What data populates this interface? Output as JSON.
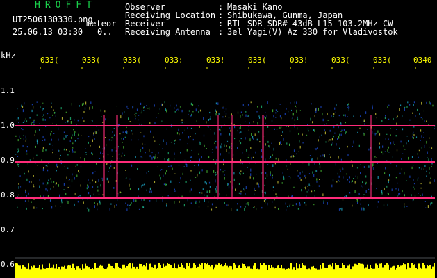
{
  "header": {
    "app_title": "HROFFT",
    "file_name": "UT2506130330.png",
    "mode": "meteor",
    "datetime": "25.06.13 03:30",
    "counter": "0..",
    "rows": [
      {
        "label": "Observer",
        "value": "Masaki Kano"
      },
      {
        "label": "Receiving Location",
        "value": "Shibukawa, Gunma, Japan"
      },
      {
        "label": "Receiver",
        "value": "RTL-SDR SDR# 43dB L15 103.2MHz CW"
      },
      {
        "label": "Receiving Antenna",
        "value": "3el Yagi(V) Az 330 for Vladivostok"
      }
    ]
  },
  "axis": {
    "y_unit": "kHz",
    "y_ticks": [
      "1.1",
      "1.0",
      "0.9",
      "0.8",
      "0.7",
      "0.6"
    ],
    "x_ticks": [
      "033(",
      "033(",
      "033(",
      "033:",
      "033!",
      "033(",
      "033!",
      "033(",
      "033(",
      "0340"
    ]
  },
  "colors": {
    "background": "#000000",
    "title_green": "#19d04b",
    "tick_yellow": "#ffff00",
    "signal_magenta": "#ff2b7a",
    "noise_blue": "#1d4fd8"
  }
}
